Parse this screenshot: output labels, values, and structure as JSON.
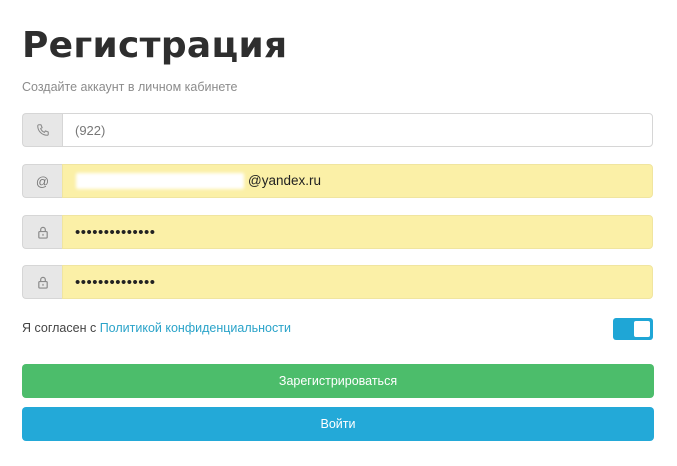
{
  "header": {
    "title": "Регистрация",
    "subtitle": "Создайте аккаунт в личном кабинете"
  },
  "form": {
    "phone": {
      "icon": "phone-icon",
      "value": "",
      "placeholder": "(922)"
    },
    "email": {
      "icon": "at-icon",
      "at_symbol": "@",
      "value": "@yandex.ru"
    },
    "password": {
      "icon": "lock-icon",
      "value": "••••••••••••••"
    },
    "password_confirm": {
      "icon": "lock-icon",
      "value": "••••••••••••••"
    }
  },
  "consent": {
    "text": "Я согласен с ",
    "link_text": "Политикой конфиденциальности",
    "checked": true
  },
  "buttons": {
    "register_label": "Зарегистрироваться",
    "login_label": "Войти"
  },
  "colors": {
    "autofill_bg": "#fbf0a7",
    "register_green": "#4cbd6b",
    "login_blue": "#23a9d8",
    "link": "#2aa3c9",
    "toggle_on": "#1fa6d6"
  }
}
